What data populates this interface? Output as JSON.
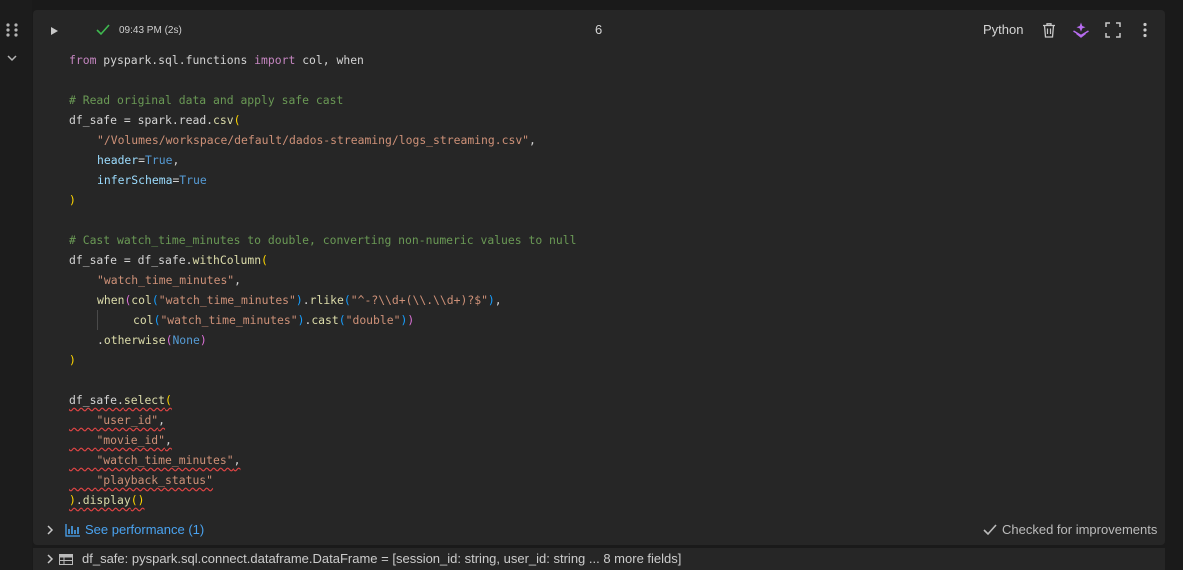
{
  "cell": {
    "run_time": "09:43 PM (2s)",
    "number": "6",
    "language": "Python"
  },
  "code": {
    "import_from": "from",
    "import_module": "pyspark.sql.functions",
    "import_kw": "import",
    "import_names": "col, when",
    "comment1": "# Read original data and apply safe cast",
    "var": "df_safe",
    "eq": " = ",
    "spark_read": "spark.read.",
    "csv_fn": "csv",
    "path": "\"/Volumes/workspace/default/dados-streaming/logs_streaming.csv\"",
    "header_kw": "header",
    "infer_kw": "inferSchema",
    "true_val": "True",
    "comment2": "# Cast watch_time_minutes to double, converting non-numeric values to null",
    "with_column_prefix": "df_safe.",
    "with_column": "withColumn",
    "col_name": "\"watch_time_minutes\"",
    "when_fn": "when",
    "col_fn": "col",
    "rlike_fn": "rlike",
    "regex": "\"^-?\\\\d+(\\\\.\\\\d+)?$\"",
    "cast_fn": "cast",
    "double_str": "\"double\"",
    "otherwise_fn": "otherwise",
    "none_val": "None",
    "select_prefix": "df_safe.",
    "select_fn": "select",
    "sel_user": "\"user_id\"",
    "sel_movie": "\"movie_id\"",
    "sel_watch": "\"watch_time_minutes\"",
    "sel_status": "\"playback_status\"",
    "display_fn": "display"
  },
  "footer": {
    "performance_link": "See performance (1)",
    "improvements_label": "Checked for improvements"
  },
  "result": {
    "text": "df_safe:  pyspark.sql.connect.dataframe.DataFrame = [session_id: string, user_id: string ... 8 more fields]"
  }
}
